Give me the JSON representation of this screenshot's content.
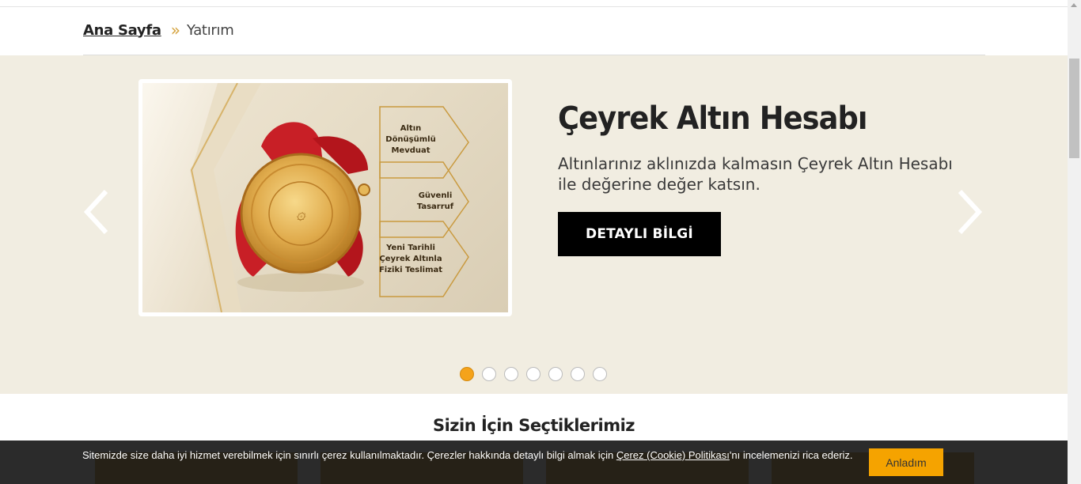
{
  "breadcrumb": {
    "home": "Ana Sayfa",
    "separator": "»",
    "current": "Yatırım"
  },
  "hero": {
    "title": "Çeyrek Altın Hesabı",
    "description": "Altınlarınız aklınızda kalmasın Çeyrek Altın Hesabı ile değerine değer katsın.",
    "button": "DETAYLI BİLGİ",
    "image_labels": {
      "hex1": [
        "Altın",
        "Dönüşümlü",
        "Mevduat"
      ],
      "hex2": [
        "Güvenli",
        "Tasarruf"
      ],
      "hex3": [
        "Yeni Tarihli",
        "Çeyrek Altınla",
        "Fiziki Teslimat"
      ]
    },
    "slide_count": 7,
    "active_slide": 1
  },
  "section": {
    "title": "Sizin İçin Seçtiklerimiz"
  },
  "cookie": {
    "text_before": "Sitemizde size daha iyi hizmet verebilmek için sınırlı çerez kullanılmaktadır. Çerezler hakkında detaylı bilgi almak için ",
    "link": "Çerez (Cookie) Politikası",
    "text_after": "'nı incelemenizi rica ederiz.",
    "button": "Anladım"
  },
  "colors": {
    "accent": "#f5a31a",
    "hero_bg": "#f1ede1",
    "button_bg": "#000000",
    "cookie_button": "#f5a300"
  },
  "icons": {
    "prev": "chevron-left-icon",
    "next": "chevron-right-icon"
  }
}
